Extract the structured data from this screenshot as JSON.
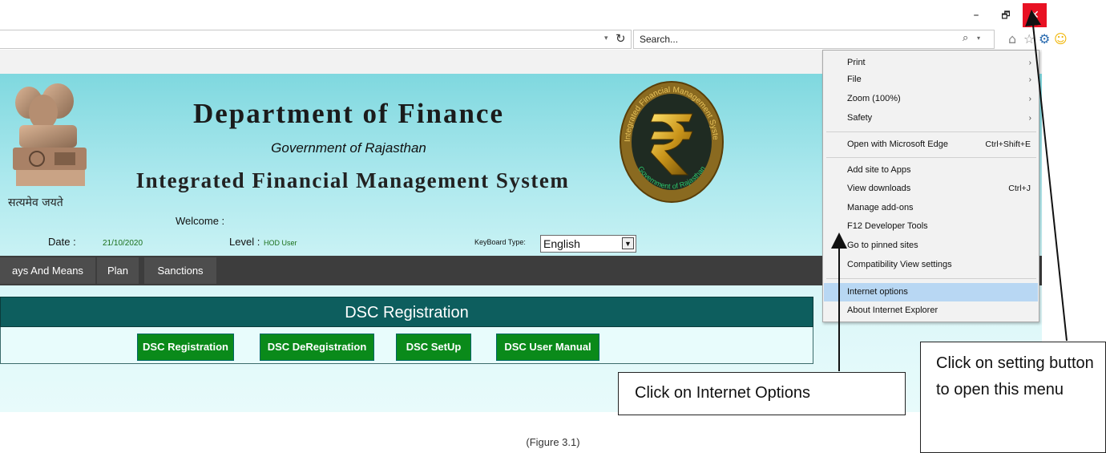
{
  "window": {
    "minimize_glyph": "–",
    "restore_glyph": "🗗",
    "close_glyph": "✕",
    "close_color": "#e81123"
  },
  "addressbar": {
    "dropdown_glyph": "▾",
    "refresh_glyph": "↻"
  },
  "search": {
    "placeholder": "Search...",
    "icon": "search-icon",
    "dropdown_glyph": "▾"
  },
  "toolbar_icons": [
    "home-icon",
    "star-icon",
    "gear-icon",
    "smiley-icon"
  ],
  "site": {
    "emblem_caption": "सत्यमेव जयते",
    "title": "Department of Finance",
    "subtitle": "Government of Rajasthan",
    "system": "Integrated Financial Management System",
    "logo_text_top": "Integrated Financial Management System",
    "logo_text_bottom": "Government of Rajasthan",
    "welcome_label": "Welcome :",
    "date_label": "Date :",
    "date_value": "21/10/2020",
    "level_label": "Level :",
    "level_value": "HOD User",
    "keyboard_label": "KeyBoard Type:",
    "keyboard_value": "English"
  },
  "nav": {
    "items": [
      "ays And Means",
      "Plan",
      "Sanctions"
    ]
  },
  "dsc": {
    "title": "DSC Registration",
    "buttons": [
      "DSC Registration",
      "DSC DeRegistration",
      "DSC SetUp",
      "DSC User Manual"
    ]
  },
  "menu": {
    "items": [
      {
        "label": "Print",
        "shortcut": "",
        "submenu": true
      },
      {
        "label": "File",
        "shortcut": "",
        "submenu": true
      },
      {
        "label": "Zoom (100%)",
        "shortcut": "",
        "submenu": true
      },
      {
        "label": "Safety",
        "shortcut": "",
        "submenu": true
      },
      {
        "label": "Open with Microsoft Edge",
        "shortcut": "Ctrl+Shift+E",
        "submenu": false
      },
      {
        "label": "Add site to Apps",
        "shortcut": "",
        "submenu": false
      },
      {
        "label": "View downloads",
        "shortcut": "Ctrl+J",
        "submenu": false
      },
      {
        "label": "Manage add-ons",
        "shortcut": "",
        "submenu": false
      },
      {
        "label": "F12 Developer Tools",
        "shortcut": "",
        "submenu": false
      },
      {
        "label": "Go to pinned sites",
        "shortcut": "",
        "submenu": false
      },
      {
        "label": "Compatibility View settings",
        "shortcut": "",
        "submenu": false
      },
      {
        "label": "Internet options",
        "shortcut": "",
        "submenu": false,
        "highlighted": true
      },
      {
        "label": "About Internet Explorer",
        "shortcut": "",
        "submenu": false
      }
    ],
    "submenu_glyph": "›"
  },
  "callouts": {
    "internet_options": "Click on Internet Options",
    "settings": "Click on setting button to open this menu"
  },
  "caption": "(Figure 3.1)"
}
